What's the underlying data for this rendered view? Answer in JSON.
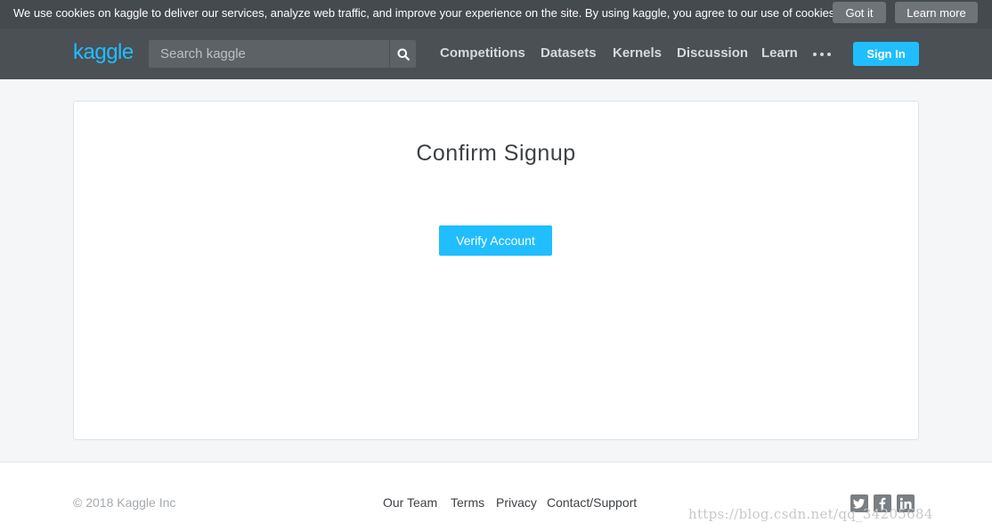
{
  "cookie_bar": {
    "text": "We use cookies on kaggle to deliver our services, analyze web traffic, and improve your experience on the site. By using kaggle, you agree to our use of cookies.",
    "got_it_label": "Got it",
    "learn_more_label": "Learn more"
  },
  "header": {
    "logo": "kaggle",
    "search_placeholder": "Search kaggle",
    "nav": [
      "Competitions",
      "Datasets",
      "Kernels",
      "Discussion",
      "Learn"
    ],
    "sign_in_label": "Sign In",
    "accent_color": "#20beff"
  },
  "main": {
    "title": "Confirm Signup",
    "verify_label": "Verify Account"
  },
  "footer": {
    "copyright": "© 2018 Kaggle Inc",
    "links": [
      "Our Team",
      "Terms",
      "Privacy",
      "Contact/Support"
    ],
    "social_icons": [
      "twitter-icon",
      "facebook-icon",
      "linkedin-icon"
    ],
    "watermark": "https://blog.csdn.net/qq_34205684"
  }
}
